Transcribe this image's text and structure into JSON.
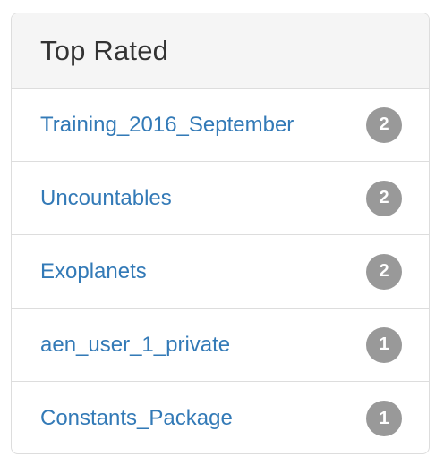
{
  "panel": {
    "title": "Top Rated",
    "items": [
      {
        "label": "Training_2016_September",
        "count": "2"
      },
      {
        "label": "Uncountables",
        "count": "2"
      },
      {
        "label": "Exoplanets",
        "count": "2"
      },
      {
        "label": "aen_user_1_private",
        "count": "1"
      },
      {
        "label": "Constants_Package",
        "count": "1"
      }
    ]
  },
  "colors": {
    "link": "#337ab7",
    "badge": "#999999",
    "heading_bg": "#f5f5f5",
    "border": "#dddddd"
  }
}
